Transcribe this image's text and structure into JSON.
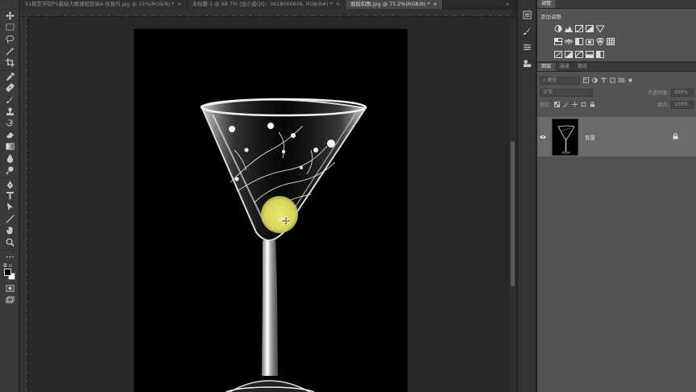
{
  "tabs": [
    {
      "label": "91择范学院PS基础大概课程目录A-恢复的.jpg @ 25%(RGB/8) *",
      "close": "×",
      "active": false
    },
    {
      "label": "未标题-1 @ 88.7% (加小盛QQ：3618066808, RGB/8#) *",
      "close": "×",
      "active": false
    },
    {
      "label": "酸版扣图.jpg @ 75.2%(RGB/8) *",
      "close": "×",
      "active": true
    }
  ],
  "tab_overflow": "»",
  "tools": [
    "move-tool",
    "marquee-tool",
    "lasso-tool",
    "magic-wand-tool",
    "crop-tool",
    "eyedropper-tool",
    "healing-brush-tool",
    "brush-tool",
    "clone-stamp-tool",
    "history-brush-tool",
    "eraser-tool",
    "gradient-tool",
    "blur-tool",
    "dodge-tool",
    "pen-tool",
    "type-tool",
    "path-selection-tool",
    "line-tool",
    "hand-tool",
    "zoom-tool",
    "more-tools"
  ],
  "colors": {
    "foreground": "#000000",
    "background": "#ffffff",
    "accent": "#dada5a"
  },
  "adjustments": {
    "tab_label": "调整",
    "title": "添加调整"
  },
  "layers_panel": {
    "tabs": [
      "图层",
      "通道",
      "路径"
    ],
    "filter_placeholder": "类型",
    "blend_mode": "正常",
    "opacity_label": "不透明度:",
    "opacity_value": "100%",
    "lock_label": "锁定:",
    "fill_label": "填充:",
    "fill_value": "100%",
    "layers": [
      {
        "name": "背景",
        "visible": true,
        "locked": true
      }
    ]
  }
}
